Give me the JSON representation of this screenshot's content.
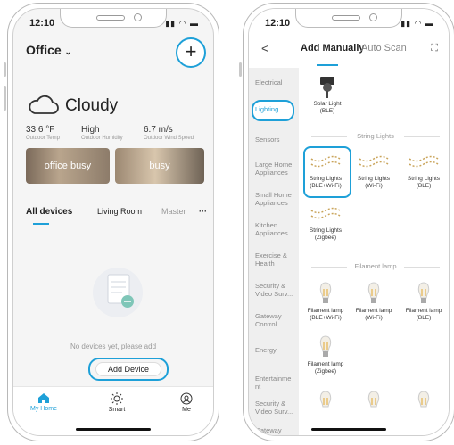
{
  "left": {
    "time": "12:10",
    "home_name": "Office",
    "add_label": "+",
    "weather": "Cloudy",
    "stats": [
      {
        "value": "33.6 °F",
        "label": "Outdoor Temp"
      },
      {
        "value": "High",
        "label": "Outdoor Humidity"
      },
      {
        "value": "6.7 m/s",
        "label": "Outdoor Wind Speed"
      }
    ],
    "scenes": [
      "office busy",
      "busy"
    ],
    "tabs": [
      "All devices",
      "Living Room",
      "Master",
      "···"
    ],
    "empty_text": "No devices yet, please add",
    "add_device": "Add Device",
    "tabbar": [
      "My Home",
      "Smart",
      "Me"
    ]
  },
  "right": {
    "time": "12:10",
    "header": {
      "back": "<",
      "tab_manual": "Add Manually",
      "tab_auto": "Auto Scan"
    },
    "categories": [
      "Electrical",
      "Lighting",
      "Sensors",
      "Large Home Appliances",
      "Small Home Appliances",
      "Kitchen Appliances",
      "Exercise & Health",
      "Security & Video Surv...",
      "Gateway Control",
      "Energy",
      "Entertainment",
      "Security & Video Surv...",
      "Gateway Control"
    ],
    "sections": [
      "String Lights",
      "Filament lamp"
    ],
    "products": {
      "solar": "Solar Light (BLE)",
      "string": [
        "String Lights (BLE+Wi-Fi)",
        "String Lights (Wi-Fi)",
        "String Lights (BLE)",
        "String Lights (Zigbee)"
      ],
      "filament": [
        "Filament lamp (BLE+Wi-Fi)",
        "Filament lamp (Wi-Fi)",
        "Filament lamp (BLE)",
        "Filament lamp (Zigbee)"
      ]
    }
  },
  "colors": {
    "accent": "#1ea0d8"
  }
}
